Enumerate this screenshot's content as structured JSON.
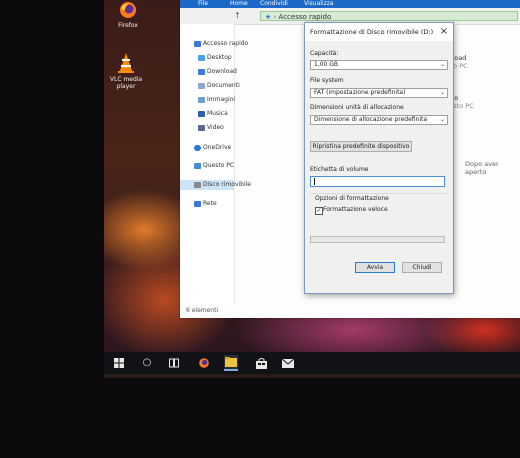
{
  "desktop": {
    "icons": [
      {
        "label": "Firefox",
        "icon": "firefox-icon"
      },
      {
        "label": "VLC media player",
        "icon": "vlc-cone-icon"
      }
    ]
  },
  "explorer": {
    "ribbon_tabs": [
      "File",
      "Home",
      "Condividi",
      "Visualizza"
    ],
    "address": "Accesso rapido",
    "nav_items": [
      {
        "label": "Accesso rapido",
        "icon": "star-icon",
        "color": "#3a7bd5"
      },
      {
        "label": "Desktop",
        "icon": "desktop-folder-icon",
        "color": "#4aa3df"
      },
      {
        "label": "Download",
        "icon": "download-folder-icon",
        "color": "#3a7bd5"
      },
      {
        "label": "Documenti",
        "icon": "documents-folder-icon",
        "color": "#8aa6c8"
      },
      {
        "label": "Immagini",
        "icon": "pictures-folder-icon",
        "color": "#6a9fd0"
      },
      {
        "label": "Musica",
        "icon": "music-icon",
        "color": "#2d5fa8"
      },
      {
        "label": "Video",
        "icon": "video-folder-icon",
        "color": "#5a6a8a"
      },
      {
        "label": "OneDrive",
        "icon": "onedrive-cloud-icon",
        "color": "#2a78d8"
      },
      {
        "label": "Questo PC",
        "icon": "this-pc-icon",
        "color": "#3e8ed6"
      },
      {
        "label": "Disco rimovibile",
        "icon": "drive-icon",
        "color": "#888888"
      },
      {
        "label": "Rete",
        "icon": "network-icon",
        "color": "#3a7bd5"
      }
    ],
    "right_items": [
      {
        "title": "Download",
        "sub": "Questo PC",
        "icon": "download-folder-icon"
      },
      {
        "title": "Video",
        "sub": "Questo PC",
        "icon": "video-folder-icon"
      }
    ],
    "recent_hint": "Dopo aver aperto",
    "status": "6 elementi"
  },
  "dialog": {
    "title": "Formattazione di Disco rimovibile (D:)",
    "capacity_label": "Capacità:",
    "capacity_value": "1,00 GB",
    "fs_label": "File system",
    "fs_value": "FAT (impostazione predefinita)",
    "alloc_label": "Dimensioni unità di allocazione",
    "alloc_value": "Dimensione di allocazione predefinita",
    "restore_button": "Ripristina predefinite dispositivo",
    "volume_label": "Etichetta di volume",
    "volume_value": "",
    "options_label": "Opzioni di formattazione",
    "quick_format_label": "Formattazione veloce",
    "quick_format_checked": true,
    "progress_fraction": 0,
    "start_button": "Avvia",
    "close_button": "Chiudi"
  },
  "taskbar": {
    "icons": [
      "windows-start-icon",
      "search-circle-icon",
      "task-view-icon",
      "firefox-icon",
      "file-explorer-icon",
      "store-icon",
      "mail-icon"
    ],
    "active": "file-explorer-icon"
  }
}
